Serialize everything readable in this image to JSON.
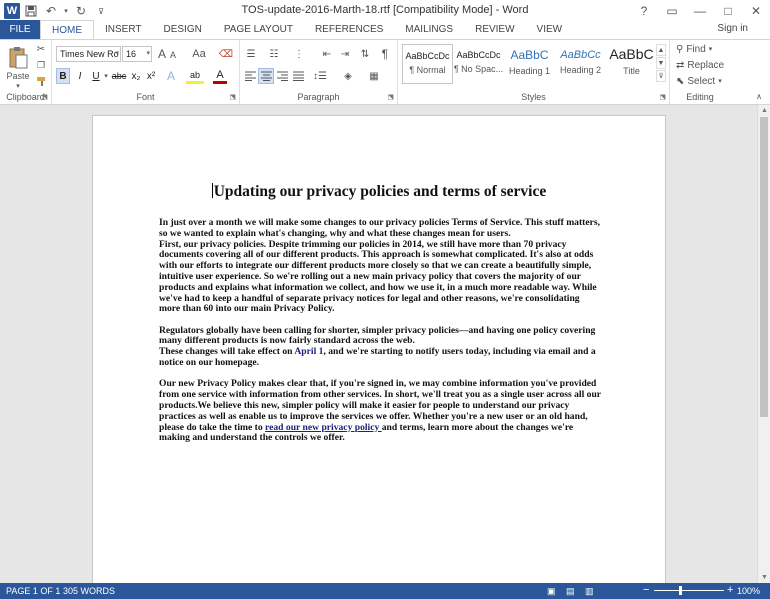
{
  "window": {
    "title": "TOS-update-2016-Marth-18.rtf [Compatibility Mode] - Word",
    "app_letter": "W",
    "controls": [
      "?",
      "▭",
      "—",
      "□",
      "✕"
    ]
  },
  "tabs": [
    {
      "label": "FILE"
    },
    {
      "label": "HOME"
    },
    {
      "label": "INSERT"
    },
    {
      "label": "DESIGN"
    },
    {
      "label": "PAGE LAYOUT"
    },
    {
      "label": "REFERENCES"
    },
    {
      "label": "MAILINGS"
    },
    {
      "label": "REVIEW"
    },
    {
      "label": "VIEW"
    }
  ],
  "signin_label": "Sign in",
  "ribbon": {
    "clipboard": {
      "label": "Clipboard",
      "paste_label": "Paste"
    },
    "font": {
      "label": "Font",
      "font_name": "Times New Ro",
      "font_size": "16",
      "grow_label": "A",
      "shrink_label": "A",
      "aa_label": "Aa",
      "bold": "B",
      "italic": "I",
      "underline": "U",
      "strike": "abc",
      "sub": "x₂",
      "sup": "x²",
      "effects": "A",
      "highlight": "ab",
      "color": "A"
    },
    "paragraph": {
      "label": "Paragraph",
      "pilcrow": "¶"
    },
    "styles": {
      "label": "Styles",
      "items": [
        {
          "sample": "AaBbCcDc",
          "name": "¶ Normal"
        },
        {
          "sample": "AaBbCcDc",
          "name": "¶ No Spac..."
        },
        {
          "sample": "AaBbC",
          "name": "Heading 1"
        },
        {
          "sample": "AaBbCc",
          "name": "Heading 2"
        },
        {
          "sample": "AaBbC",
          "name": "Title"
        }
      ]
    },
    "editing": {
      "label": "Editing",
      "find": "Find",
      "replace": "Replace",
      "select": "Select"
    }
  },
  "document": {
    "heading": "Updating our privacy policies and terms of service",
    "p1a": "In just over a month we will make some changes to our privacy policies Terms of Service. This stuff matters, so we wanted to explain what's changing, why and what these changes mean for users.",
    "p1b": "First, our privacy policies. Despite trimming our policies in 2014, we still have more than 70 privacy documents covering all of our different products. This approach is somewhat complicated. It's also at odds with our efforts to integrate our different products more closely so that we can create a beautifully simple, intuitive user experience. So we're rolling out a new main privacy policy that covers the majority of our products and explains what information we collect, and how we use it, in a much more readable way. While we've had to keep a handful of separate privacy notices for legal and other reasons, we're consolidating more than 60 into our main Privacy Policy.",
    "p2a": "Regulators globally have been calling for shorter, simpler privacy policies—and having one policy covering many different products is now fairly standard across the web.",
    "p2b_start": "These changes will take effect on ",
    "p2b_link": "April 1",
    "p2b_end": ", and we're starting to notify users today, including via email and a notice on our homepage.",
    "p3_start": "Our new Privacy Policy makes clear that, if you're signed in, we may combine information you've provided from one service with information from other services. In short, we'll treat you as a single user across all our products.We believe this new, simpler policy will make it easier for people to understand our privacy practices as well as enable us to improve the services we offer. Whether you're a new user or an old hand, please do take the time to ",
    "p3_link": "read our new privacy policy ",
    "p3_end": "and terms, learn more about the changes we're making and understand the controls we offer."
  },
  "status": {
    "page": "PAGE 1 OF 1",
    "words": "305 WORDS",
    "zoom": "100%",
    "zoom_minus": "−",
    "zoom_plus": "+"
  },
  "colors": {
    "accent": "#2b579a",
    "link": "#1a237e"
  }
}
